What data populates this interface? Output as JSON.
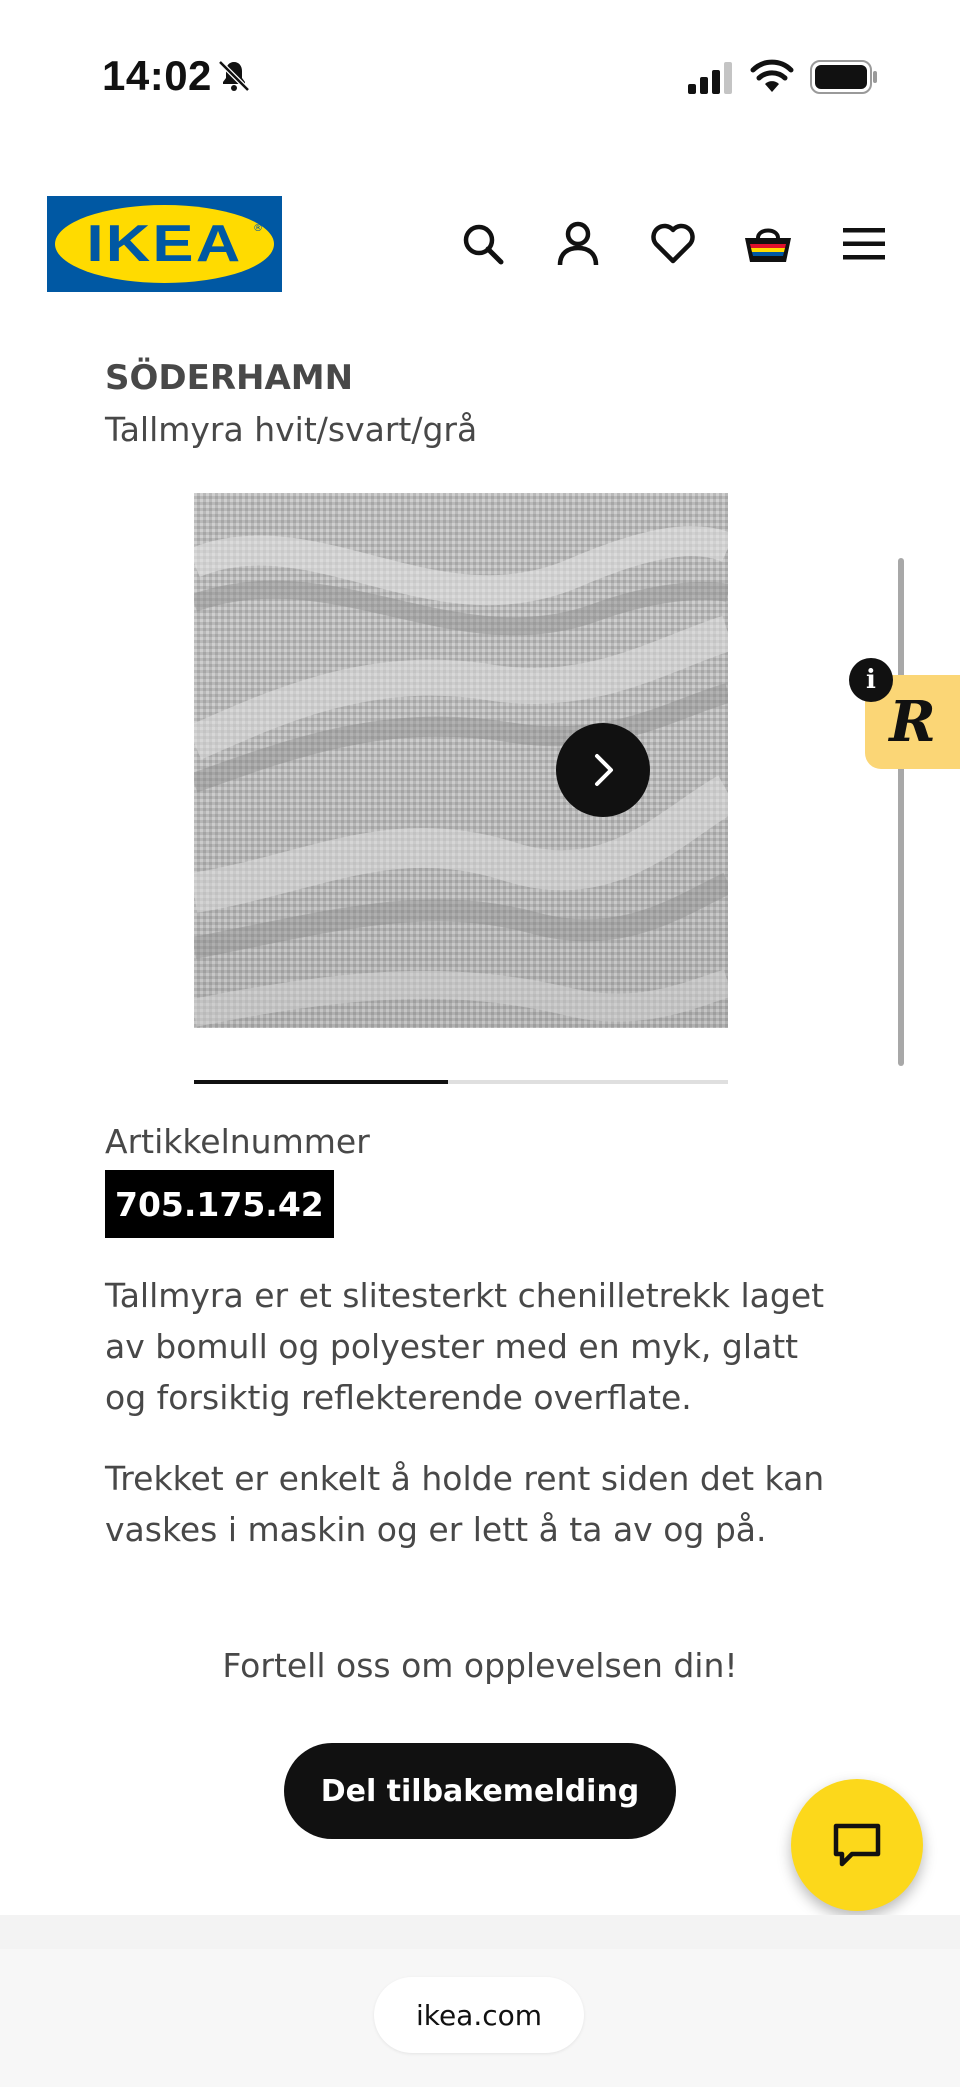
{
  "status_bar": {
    "time": "14:02",
    "icons": [
      "bell-slash-icon",
      "cellular-signal-icon",
      "wifi-icon",
      "battery-icon"
    ]
  },
  "header": {
    "logo_text": "IKEA",
    "logo_registered": "®",
    "icons": [
      "search-icon",
      "account-icon",
      "heart-icon",
      "basket-icon",
      "menu-icon"
    ],
    "colors": {
      "logo_blue": "#0058a3",
      "logo_yellow": "#ffdb00"
    }
  },
  "product": {
    "name": "SÖDERHAMN",
    "description": "Tallmyra hvit/svart/grå",
    "image_alt": "fabric swatch",
    "gallery_progress": 0.475,
    "article_label": "Artikkelnummer",
    "article_number": "705.175.42",
    "paragraph_1": "Tallmyra er et slitesterkt chenilletrekk laget av bomull og polyester med en myk, glatt og forsiktig reflekterende overflate.",
    "paragraph_2": "Trekket er enkelt å holde rent siden det kan vaskes i maskin og er lett å ta av og på."
  },
  "overlay": {
    "info_label": "i",
    "badge_letter": "R"
  },
  "feedback": {
    "prompt": "Fortell oss om opplevelsen din!",
    "button_label": "Del tilbakemelding"
  },
  "browser": {
    "url": "ikea.com"
  },
  "colors": {
    "chat_button": "#fcd81b",
    "badge": "#fbd676",
    "text": "#484848"
  }
}
